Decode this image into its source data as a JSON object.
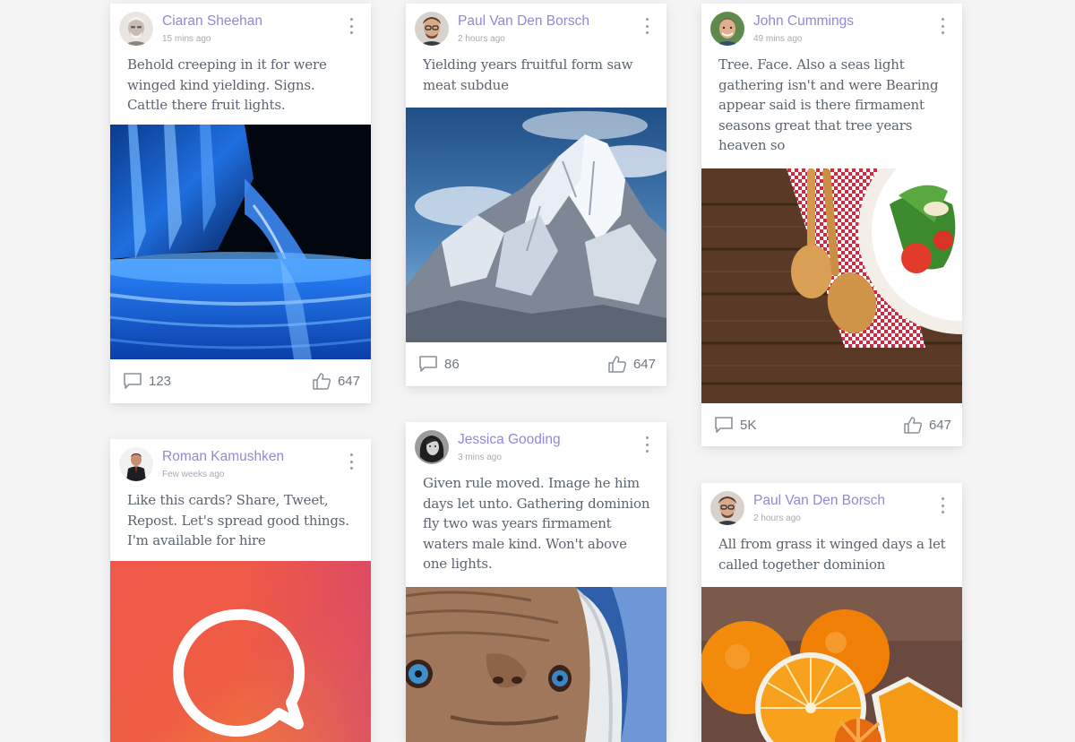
{
  "colors": {
    "accent": "#8f8ad6",
    "background": "#f4f4f5",
    "card": "#ffffff",
    "text": "#5b6470",
    "muted": "#a9a9b3"
  },
  "cards": [
    {
      "author": "Ciaran Sheehan",
      "time": "15 mins ago",
      "text": "Behold creeping in it for were winged kind yielding. Signs. Cattle there fruit lights.",
      "comments": "123",
      "likes": "647",
      "image": "water-bottle-photo",
      "avatar": "elderly-man-portrait"
    },
    {
      "author": "Paul Van Den Borsch",
      "time": "2 hours ago",
      "text": "Yielding years fruitful form saw meat subdue",
      "comments": "86",
      "likes": "647",
      "image": "snowy-mountain-photo",
      "avatar": "man-with-glasses-portrait"
    },
    {
      "author": "John Cummings",
      "time": "49 mins ago",
      "text": "Tree. Face. Also a seas light gathering isn't and were Bearing appear said is there firmament seasons great that tree years heaven so",
      "comments": "5K",
      "likes": "647",
      "image": "salad-spoons-photo",
      "avatar": "smiling-man-portrait"
    },
    {
      "author": "Roman Kamushken",
      "time": "Few weeks ago",
      "text": "Like this cards? Share, Tweet, Repost. Let's spread good things. I'm available for hire",
      "image": "chat-bubble-gradient",
      "avatar": "man-in-suit-portrait"
    },
    {
      "author": "Jessica Gooding",
      "time": "3 mins ago",
      "text": "Given rule moved. Image he him days let unto. Gathering dominion fly two was years firmament waters male kind. Won't above one lights.",
      "image": "alien-closeup-photo",
      "avatar": "woman-portrait"
    },
    {
      "author": "Paul Van Den Borsch",
      "time": "2 hours ago",
      "text": "All from grass it winged days a let called together dominion",
      "image": "oranges-photo",
      "avatar": "man-with-glasses-portrait"
    }
  ]
}
